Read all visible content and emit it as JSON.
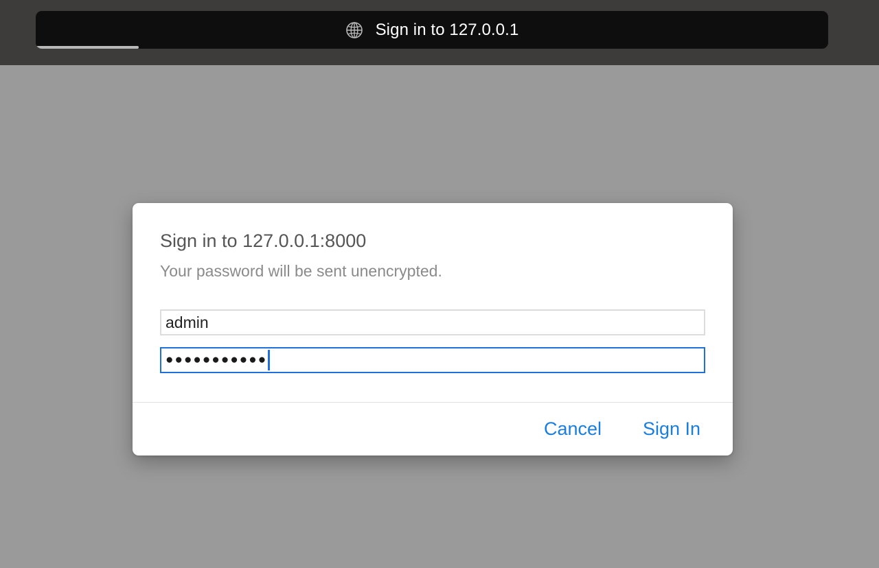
{
  "browser": {
    "address_title": "Sign in to 127.0.0.1",
    "page_icon": "globe-icon",
    "load_progress": 0.13
  },
  "dialog": {
    "title": "Sign in to 127.0.0.1:8000",
    "subtitle": "Your password will be sent unencrypted.",
    "username_value": "admin",
    "password_masked": "●●●●●●●●●●●",
    "cancel_label": "Cancel",
    "signin_label": "Sign In"
  },
  "colors": {
    "accent": "#1a7de0",
    "focus_border": "#1f6fdc",
    "overlay_background": "#9a9a9a",
    "chrome_background": "#3e3b3b"
  }
}
